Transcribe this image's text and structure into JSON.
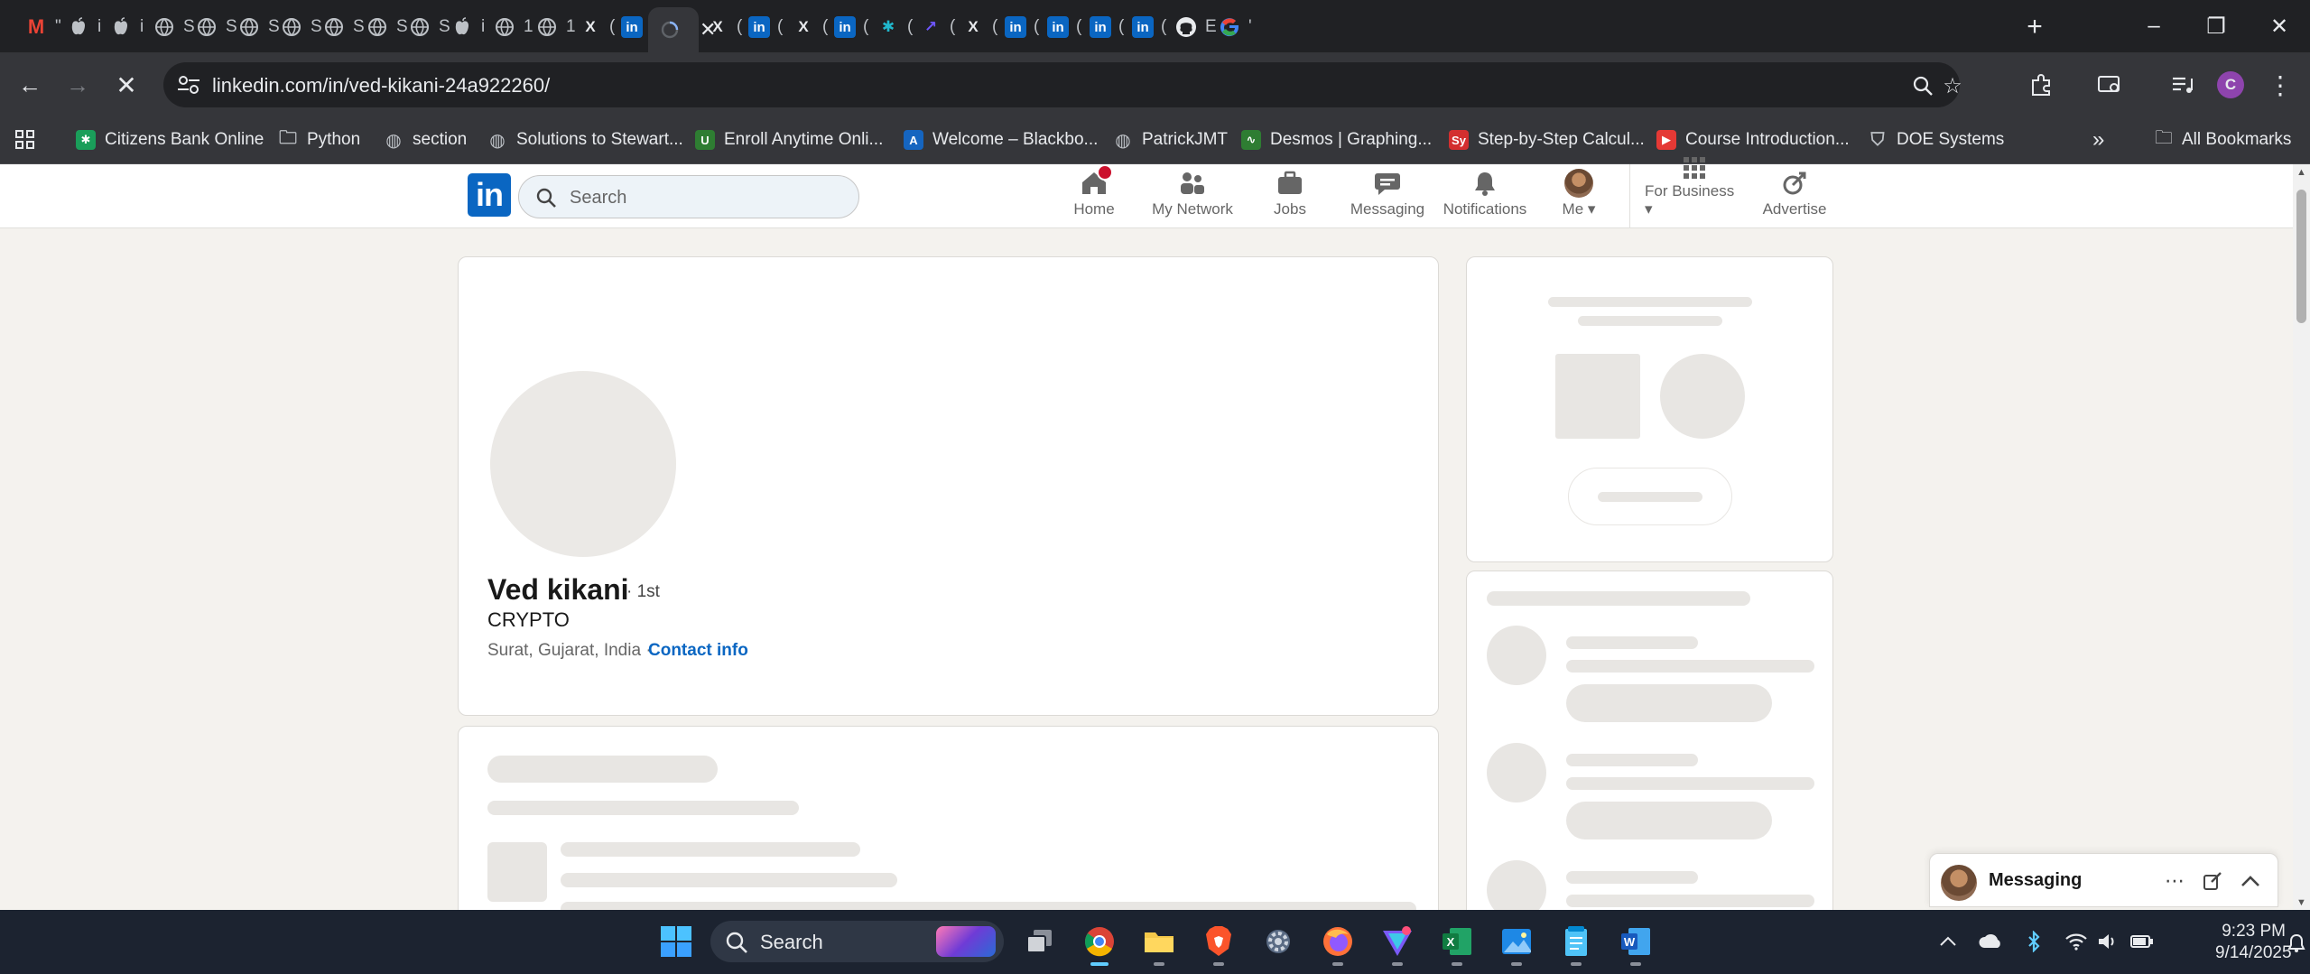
{
  "browser": {
    "tabs": [
      {
        "icon": "gmail-icon",
        "label": "M",
        "color": "#ea4335",
        "title": "\""
      },
      {
        "icon": "apple-icon",
        "label": "",
        "color": "#e8eaed",
        "title": "i"
      },
      {
        "icon": "apple-icon",
        "label": "",
        "color": "#e8eaed",
        "title": "i"
      },
      {
        "icon": "globe-icon",
        "label": "",
        "color": "#e8eaed",
        "title": "S"
      },
      {
        "icon": "globe-icon",
        "label": "",
        "color": "#e8eaed",
        "title": "S"
      },
      {
        "icon": "globe-icon",
        "label": "",
        "color": "#e8eaed",
        "title": "S"
      },
      {
        "icon": "globe-icon",
        "label": "",
        "color": "#e8eaed",
        "title": "S"
      },
      {
        "icon": "globe-icon",
        "label": "",
        "color": "#e8eaed",
        "title": "S"
      },
      {
        "icon": "globe-icon",
        "label": "",
        "color": "#e8eaed",
        "title": "S"
      },
      {
        "icon": "globe-icon",
        "label": "",
        "color": "#e8eaed",
        "title": "S"
      },
      {
        "icon": "apple-icon",
        "label": "",
        "color": "#e8eaed",
        "title": "i"
      },
      {
        "icon": "globe-icon",
        "label": "",
        "color": "#e8eaed",
        "title": "1"
      },
      {
        "icon": "globe-icon",
        "label": "",
        "color": "#e8eaed",
        "title": "1"
      },
      {
        "icon": "x-icon",
        "label": "X",
        "color": "#e8eaed",
        "title": "("
      },
      {
        "icon": "linkedin-icon",
        "label": "in",
        "color": "#0a66c2",
        "title": "("
      },
      {
        "icon": "loading-icon",
        "label": "",
        "color": "#e8eaed",
        "title": "\\",
        "active": true
      },
      {
        "icon": "x-icon",
        "label": "X",
        "color": "#e8eaed",
        "title": "("
      },
      {
        "icon": "linkedin-icon",
        "label": "in",
        "color": "#0a66c2",
        "title": "("
      },
      {
        "icon": "x-icon",
        "label": "X",
        "color": "#e8eaed",
        "title": "("
      },
      {
        "icon": "linkedin-icon",
        "label": "in",
        "color": "#0a66c2",
        "title": "("
      },
      {
        "icon": "perplexity-icon",
        "label": "✱",
        "color": "#20b8cd",
        "title": "("
      },
      {
        "icon": "arrow-app-icon",
        "label": "↗",
        "color": "#6e56ff",
        "title": "("
      },
      {
        "icon": "x-icon",
        "label": "X",
        "color": "#e8eaed",
        "title": "("
      },
      {
        "icon": "linkedin-icon",
        "label": "in",
        "color": "#0a66c2",
        "title": "("
      },
      {
        "icon": "linkedin-icon",
        "label": "in",
        "color": "#0a66c2",
        "title": "("
      },
      {
        "icon": "linkedin-icon",
        "label": "in",
        "color": "#0a66c2",
        "title": "("
      },
      {
        "icon": "linkedin-icon",
        "label": "in",
        "color": "#0a66c2",
        "title": "("
      },
      {
        "icon": "github-icon",
        "label": "●",
        "color": "#e8eaed",
        "title": "E"
      },
      {
        "icon": "google-icon",
        "label": "G",
        "color": "#4285f4",
        "title": "'"
      }
    ],
    "url": "linkedin.com/in/ved-kikani-24a922260/",
    "profile_initial": "C",
    "bookmarks": [
      {
        "label": "Citizens Bank Online",
        "icon": "citizens-icon",
        "color": "#1a9e5a",
        "glyph": "✱"
      },
      {
        "label": "Python",
        "icon": "folder-icon",
        "color": "transparent",
        "glyph": "🗀"
      },
      {
        "label": "section",
        "icon": "globe-icon",
        "color": "transparent",
        "glyph": "◍"
      },
      {
        "label": "Solutions to Stewart...",
        "icon": "globe-icon",
        "color": "transparent",
        "glyph": "◍"
      },
      {
        "label": "Enroll Anytime Onli...",
        "icon": "unr-icon",
        "color": "#2e7d32",
        "glyph": "U"
      },
      {
        "label": "Welcome – Blackbo...",
        "icon": "blackboard-icon",
        "color": "#1565c0",
        "glyph": "A"
      },
      {
        "label": "PatrickJMT",
        "icon": "globe-icon",
        "color": "transparent",
        "glyph": "◍"
      },
      {
        "label": "Desmos | Graphing...",
        "icon": "desmos-icon",
        "color": "#2e7d32",
        "glyph": "∿"
      },
      {
        "label": "Step-by-Step Calcul...",
        "icon": "symbolab-icon",
        "color": "#d32f2f",
        "glyph": "Sy"
      },
      {
        "label": "Course Introduction...",
        "icon": "youtube-icon",
        "color": "#e53935",
        "glyph": "▶"
      },
      {
        "label": "DOE Systems",
        "icon": "shield-icon",
        "color": "transparent",
        "glyph": "⛉"
      }
    ],
    "all_bookmarks": "All Bookmarks"
  },
  "linkedin": {
    "search_placeholder": "Search",
    "nav": [
      {
        "label": "Home",
        "icon": "home-icon"
      },
      {
        "label": "My Network",
        "icon": "my-network-icon"
      },
      {
        "label": "Jobs",
        "icon": "jobs-icon"
      },
      {
        "label": "Messaging",
        "icon": "messaging-icon"
      },
      {
        "label": "Notifications",
        "icon": "notifications-icon"
      },
      {
        "label": "Me",
        "icon": "me-avatar"
      },
      {
        "label": "For Business",
        "icon": "grid-icon"
      },
      {
        "label": "Advertise",
        "icon": "advertise-icon"
      }
    ],
    "profile": {
      "name": "Ved kikani",
      "degree": "· 1st",
      "headline": "CRYPTO",
      "location": "Surat, Gujarat, India ·",
      "contact_info": "Contact info"
    },
    "messaging": {
      "label": "Messaging"
    }
  },
  "taskbar": {
    "search_label": "Search",
    "time": "9:23 PM",
    "date": "9/14/2025"
  },
  "colors": {
    "linkedin_blue": "#0a66c2",
    "notification_red": "#cb112d",
    "skeleton": "#e8e6e3"
  }
}
